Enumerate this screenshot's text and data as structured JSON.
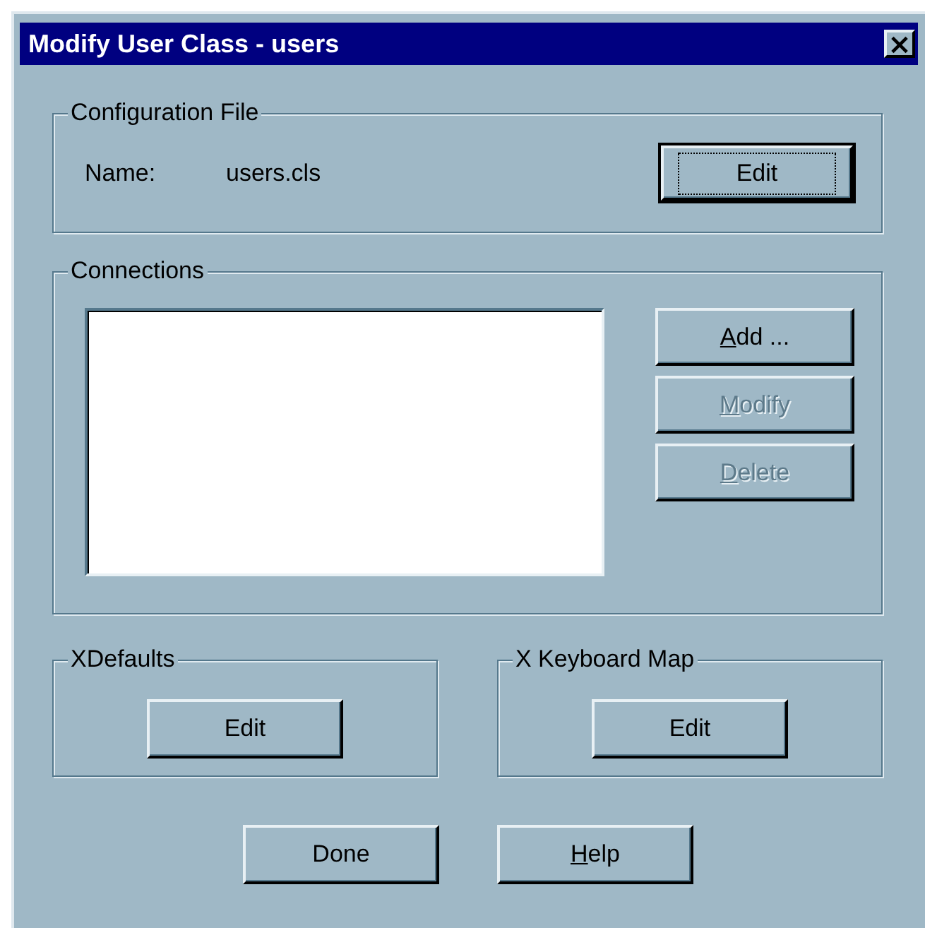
{
  "window": {
    "title": "Modify User Class - users",
    "close": "×"
  },
  "configuration_file": {
    "legend": "Configuration File",
    "name_label": "Name:",
    "name_value": "users.cls",
    "button": {
      "label": "Edit",
      "default": true,
      "disabled": false
    }
  },
  "connections": {
    "legend": "Connections",
    "buttons": [
      {
        "mnemonic": "A",
        "label_rest": "dd ...",
        "disabled": false
      },
      {
        "mnemonic": "M",
        "label_rest": "odify",
        "disabled": true
      },
      {
        "mnemonic": "D",
        "label_rest": "elete",
        "disabled": true
      }
    ]
  },
  "xdefaults": {
    "legend": "XDefaults",
    "button": {
      "label": "Edit",
      "default": false,
      "disabled": false
    }
  },
  "x_keyboard_map": {
    "legend": "X Keyboard Map",
    "button": {
      "label": "Edit",
      "default": false,
      "disabled": false
    }
  },
  "footer_buttons": [
    {
      "label_rest": "Done",
      "disabled": false
    },
    {
      "mnemonic": "H",
      "label_rest": "elp",
      "disabled": false
    }
  ]
}
